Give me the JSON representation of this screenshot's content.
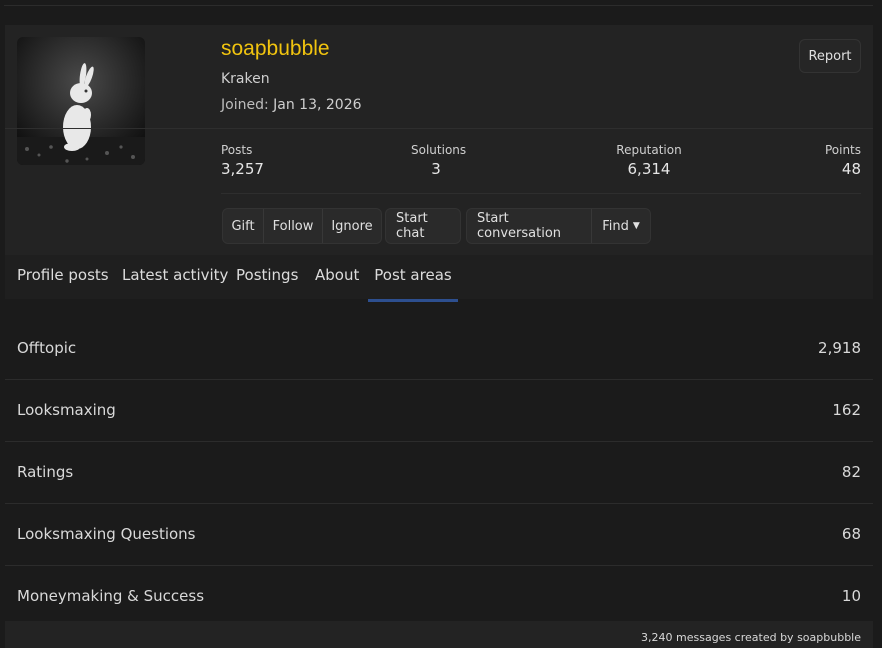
{
  "profile": {
    "username": "soapbubble",
    "user_title": "Kraken",
    "joined_label": "Joined:",
    "joined_date": "Jan 13, 2026",
    "report_label": "Report",
    "avatar_icon": "white-rabbit-avatar"
  },
  "stats": [
    {
      "label": "Posts",
      "value": "3,257"
    },
    {
      "label": "Solutions",
      "value": "3"
    },
    {
      "label": "Reputation",
      "value": "6,314"
    },
    {
      "label": "Points",
      "value": "48"
    }
  ],
  "actions": {
    "gift": "Gift",
    "follow": "Follow",
    "ignore": "Ignore",
    "start_chat": "Start chat",
    "start_conversation": "Start conversation",
    "find": "Find"
  },
  "tabs": [
    {
      "label": "Profile posts"
    },
    {
      "label": "Latest activity"
    },
    {
      "label": "Postings"
    },
    {
      "label": "About"
    },
    {
      "label": "Post areas",
      "active": true
    }
  ],
  "post_areas": [
    {
      "name": "Offtopic",
      "count": "2,918"
    },
    {
      "name": "Looksmaxing",
      "count": "162"
    },
    {
      "name": "Ratings",
      "count": "82"
    },
    {
      "name": "Looksmaxing Questions",
      "count": "68"
    },
    {
      "name": "Moneymaking & Success",
      "count": "10"
    }
  ],
  "footer": {
    "summary": "3,240 messages created by soapbubble"
  },
  "colors": {
    "username": "#f1c40f",
    "active_tab_underline": "#2d4f8f",
    "background": "#1b1b1b",
    "card": "#232323"
  }
}
